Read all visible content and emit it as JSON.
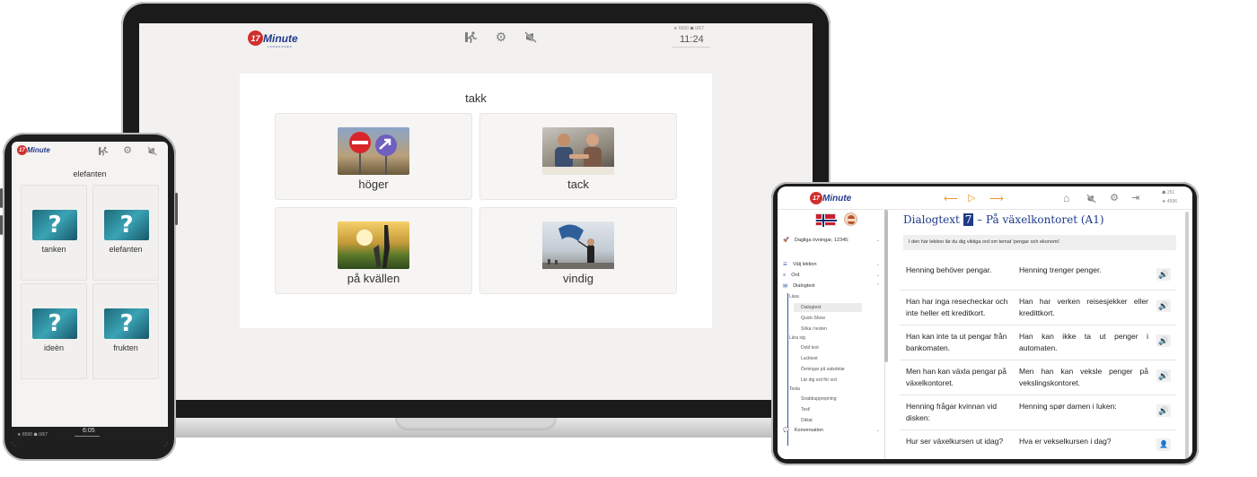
{
  "laptop": {
    "logo_num": "17",
    "logo_text": "Minute",
    "logo_sub": "LANGUAGES",
    "stats": "★ 6000 ☗ 0/67",
    "clock": "11:24",
    "prompt": "takk",
    "answers": [
      "höger",
      "tack",
      "på kvällen",
      "vindig"
    ]
  },
  "phone": {
    "logo_num": "17",
    "logo_text": "Minute",
    "prompt": "elefanten",
    "answers": [
      "tanken",
      "elefanten",
      "ideèn",
      "frukten"
    ],
    "qmark": "?",
    "stats": "★ 8590 ☗ 0/67",
    "clock": "6:05"
  },
  "tablet": {
    "logo_num": "17",
    "logo_text": "Minute",
    "stats_top": "☗ 251",
    "stats_bottom": "★ 4596",
    "sidebar": {
      "daily": "Dagliga övningar, 12345:",
      "items": [
        "Välj lektion",
        "Ord",
        "Dialogtext"
      ],
      "section_read": "Läsa",
      "read_items": [
        "Dialogtext",
        "Quick-Show",
        "Söka i texten"
      ],
      "section_learn": "Lära sig",
      "learn_items": [
        "Dold text",
        "Lucktext",
        "Övningar på satsdelar",
        "Lär dig ord för ord"
      ],
      "section_test": "Testa",
      "test_items": [
        "Snabbupprepning",
        "Test!",
        "Diktat"
      ],
      "conversation": "Konversation"
    },
    "title_pre": "Dialogtext",
    "title_num": "7",
    "title_post": "– På växelkontoret (A1)",
    "intro": "I den här lektion lär du dig viktiga ord om temat 'pengar och ekonomi'.",
    "rows": [
      {
        "sv": "Henning behöver pengar.",
        "no": "Henning trenger penger."
      },
      {
        "sv": "Han har inga resecheckar och inte heller ett kreditkort.",
        "no": "Han har verken reisesjekker eller kredittkort."
      },
      {
        "sv": "Han kan inte ta ut pengar från bankomaten.",
        "no": "Han kan ikke ta ut penger i automaten."
      },
      {
        "sv": "Men han kan växla pengar på växelkontoret.",
        "no": "Men han kan veksle penger på vekslingskontoret."
      },
      {
        "sv": "Henning frågar kvinnan vid disken:",
        "no": "Henning spør damen i luken:"
      },
      {
        "sv": "Hur ser växelkursen ut idag?",
        "no": "Hva er vekselkursen i dag?"
      }
    ],
    "speaker": "🔊",
    "person": "👤"
  }
}
